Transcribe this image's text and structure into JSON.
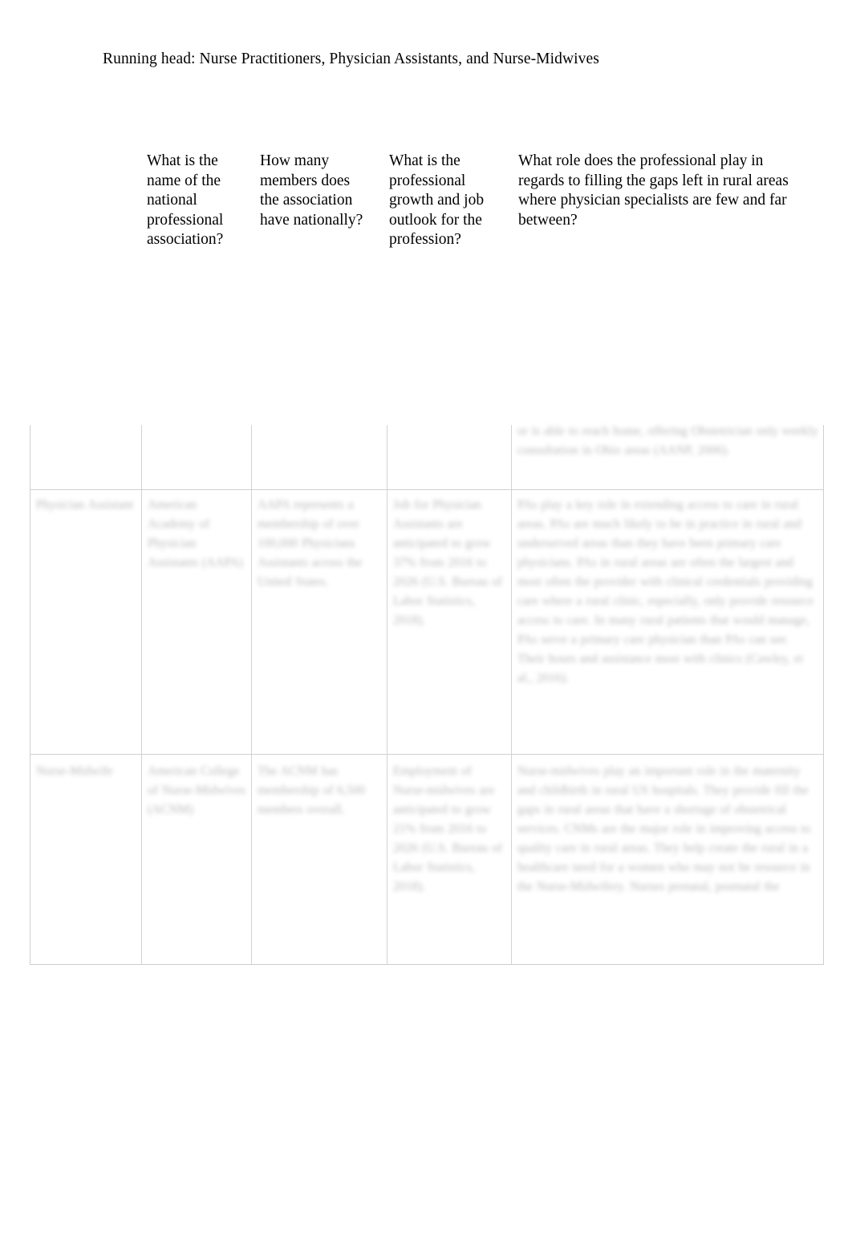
{
  "page": {
    "running_head": "Running head: Nurse Practitioners, Physician Assistants, and Nurse-Midwives",
    "background_color": "#ffffff",
    "text_color": "#000000"
  },
  "table": {
    "border_color": "#d2d2d2",
    "column_headers": [
      "What is the name of the national professional association?",
      "How many members does the association have nationally?",
      "What is the professional growth and job outlook for the profession?",
      "What role does the professional play in regards to filling the gaps left in rural areas where physician specialists are few and far between?"
    ],
    "rows": [
      {
        "label": "partial-top-row",
        "cells": [
          "",
          "",
          "",
          "",
          "or is able to reach home, offering Obstetrician only weekly consultation in Ohio areas (AANP, 2006)."
        ]
      },
      {
        "label": "nurse-practitioner-row",
        "cells": [
          "Physician Assistant",
          "American Academy of Physician Assistants (AAPA)",
          "AAPA represents a membership of over 100,000 Physicians Assistants across the United States.",
          "Job for Physician Assistants are anticipated to grow 37% from 2016 to 2026 (U.S. Bureau of Labor Statistics, 2018).",
          "PAs play a key role in extending access to care in rural areas. PAs are much likely to be in practice in rural and underserved areas than they have been primary care physicians. PAs in rural areas are often the largest and most often the provider with clinical credentials providing care where a rural clinic, especially, only provide resource access to care. In many rural patients that would manage, PAs serve a primary care physician than PAs can see. Their hours and assistance most with clinics (Cawley, et al., 2016)."
        ]
      },
      {
        "label": "nurse-midwife-row",
        "cells": [
          "Nurse-Midwife",
          "American College of Nurse-Midwives (ACNM)",
          "The ACNM has membership of 6,500 members overall.",
          "Employment of Nurse-midwives are anticipated to grow 21% from 2016 to 2026 (U.S. Bureau of Labor Statistics, 2018).",
          "Nurse-midwives play an important role in the maternity and childbirth in rural US hospitals. They provide fill the gaps in rural areas that have a shortage of obstetrical services. CNMs are the major role in improving access to quality care in rural areas. They help create the rural in a healthcare need for a women who may not be resource in the Nurse-Midwifery. Nurses prenatal, postnatal the"
        ]
      }
    ]
  }
}
